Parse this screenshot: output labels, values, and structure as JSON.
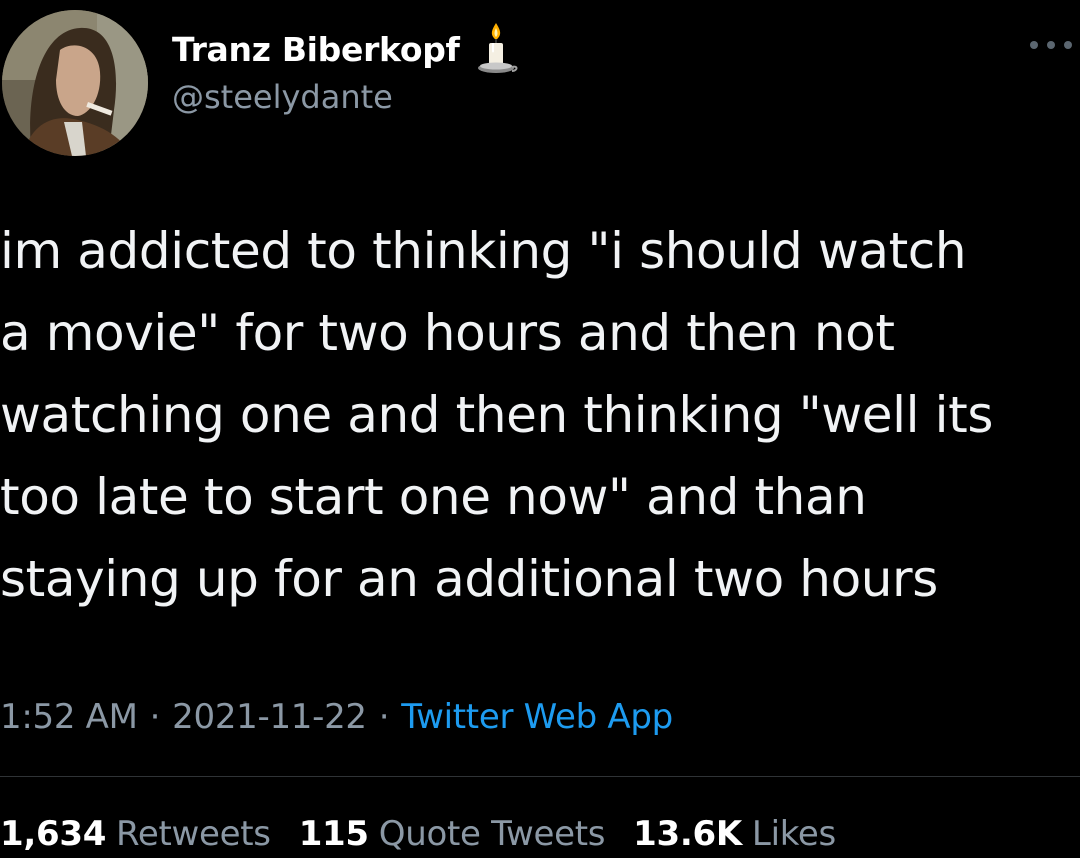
{
  "author": {
    "display_name": "Tranz Biberkopf",
    "handle": "@steelydante",
    "badge_icon": "candle-icon",
    "avatar_icon": "profile-photo"
  },
  "tweet": {
    "lines": [
      "im addicted to thinking \"i should watch",
      "a movie\" for two hours and then not",
      "watching one and then thinking \"well its",
      "too late to start one now\" and than",
      "staying up for an additional two hours"
    ]
  },
  "meta": {
    "time": "1:52 AM",
    "separator": "·",
    "date": "2021-11-22",
    "source": "Twitter Web App"
  },
  "stats": {
    "retweets": {
      "count": "1,634",
      "label": "Retweets"
    },
    "quotes": {
      "count": "115",
      "label": "Quote Tweets"
    },
    "likes": {
      "count": "13.6K",
      "label": "Likes"
    }
  },
  "colors": {
    "background": "#000000",
    "text": "#f1f3f5",
    "secondary": "#8b98a5",
    "link": "#1d9bf0",
    "divider": "#2f3336"
  },
  "icons": {
    "more": "more-dots-icon"
  }
}
